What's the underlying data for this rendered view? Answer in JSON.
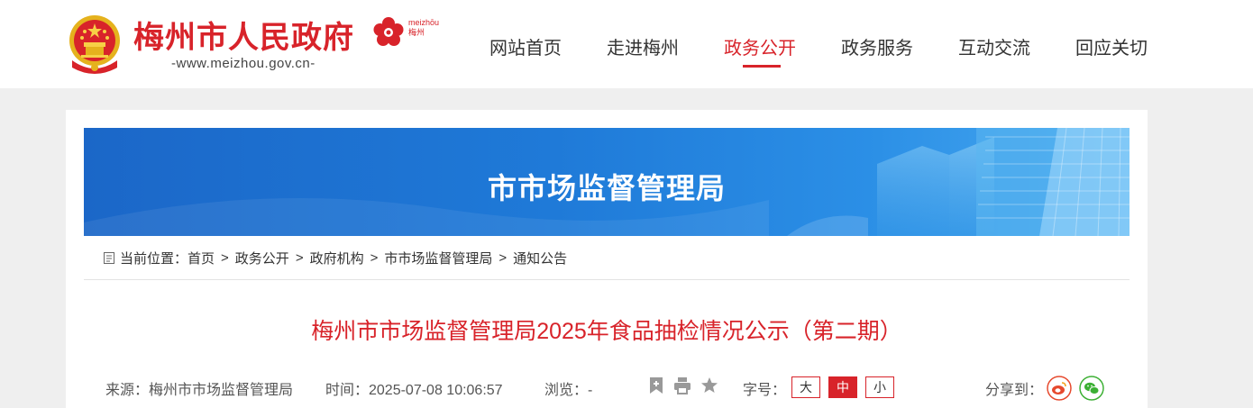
{
  "header": {
    "site_title": "梅州市人民政府",
    "site_url": "-www.meizhou.gov.cn-",
    "logo_text_top": "meizhōu",
    "logo_text_bottom": "梅州",
    "brand_color": "#d8232a"
  },
  "nav": {
    "items": [
      {
        "label": "网站首页"
      },
      {
        "label": "走进梅州"
      },
      {
        "label": "政务公开"
      },
      {
        "label": "政务服务"
      },
      {
        "label": "互动交流"
      },
      {
        "label": "回应关切"
      }
    ],
    "active": "政务公开"
  },
  "banner": {
    "title": "市市场监督管理局"
  },
  "breadcrumb": {
    "prefix": "当前位置：",
    "separator": ">",
    "items": [
      "首页",
      "政务公开",
      "政府机构",
      "市市场监督管理局",
      "通知公告"
    ]
  },
  "article": {
    "title": "梅州市市场监督管理局2025年食品抽检情况公示（第二期）",
    "source": "来源：梅州市市场监督管理局",
    "time": "时间：2025-07-08 10:06:57",
    "views": "浏览：-",
    "font_size_label": "字号：",
    "font_sizes": [
      "大",
      "中",
      "小"
    ],
    "font_size_active": "中",
    "share_label": "分享到：",
    "icons": [
      "bookmark-icon",
      "print-icon",
      "star-icon",
      "weibo-icon",
      "wechat-icon"
    ]
  }
}
